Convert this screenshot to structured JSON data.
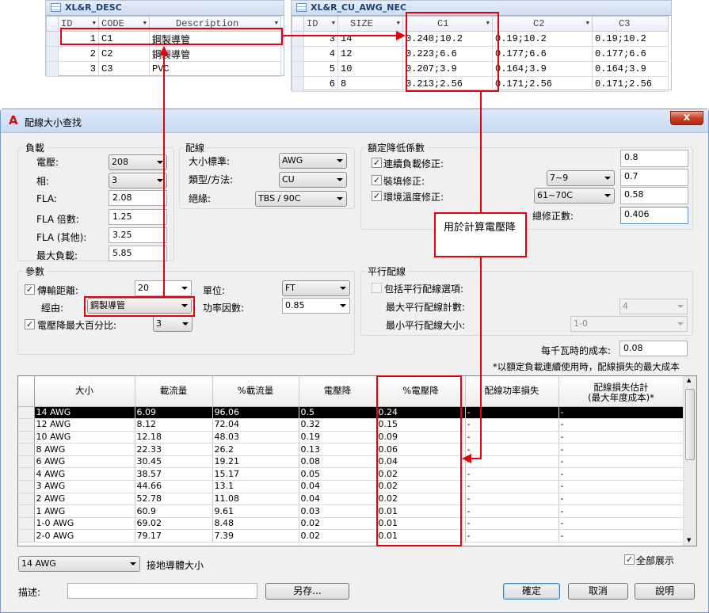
{
  "desc_table": {
    "title": "XL&R_DESC",
    "headers": [
      "ID",
      "CODE",
      "Description"
    ],
    "rows": [
      [
        "1",
        "C1",
        "鋼製導管"
      ],
      [
        "2",
        "C2",
        "鋼製導管"
      ],
      [
        "3",
        "C3",
        "PVC"
      ]
    ]
  },
  "awg_table": {
    "title": "XL&R_CU_AWG_NEC",
    "headers": [
      "ID",
      "SIZE",
      "C1",
      "C2",
      "C3"
    ],
    "rows": [
      [
        "3",
        "14",
        "0.240;10.2",
        "0.19;10.2",
        "0.19;10.2"
      ],
      [
        "4",
        "12",
        "0.223;6.6",
        "0.177;6.6",
        "0.177;6.6"
      ],
      [
        "5",
        "10",
        "0.207;3.9",
        "0.164;3.9",
        "0.164;3.9"
      ],
      [
        "6",
        "8",
        "0.213;2.56",
        "0.171;2.56",
        "0.171;2.56"
      ]
    ]
  },
  "dialog": {
    "title": "配線大小查找",
    "close": "x"
  },
  "load": {
    "title": "負載",
    "voltage_label": "電壓:",
    "voltage_value": "208",
    "phase_label": "相:",
    "phase_value": "3",
    "fla_label": "FLA:",
    "fla_value": "2.08",
    "fla_mult_label": "FLA 倍數:",
    "fla_mult_value": "1.25",
    "fla_other_label": "FLA (其他):",
    "fla_other_value": "3.25",
    "max_load_label": "最大負載:",
    "max_load_value": "5.85"
  },
  "wiring": {
    "title": "配線",
    "size_std_label": "大小標準:",
    "size_std_value": "AWG",
    "type_label": "類型/方法:",
    "type_value": "CU",
    "insulation_label": "絕緣:",
    "insulation_value": "TBS / 90C"
  },
  "derate": {
    "title": "額定降低係數",
    "continuous_label": "連續負載修正:",
    "continuous_value": "0.8",
    "fill_label": "裝填修正:",
    "fill_option": "7~9",
    "fill_value": "0.7",
    "temp_label": "環境溫度修正:",
    "temp_option": "61~70C",
    "temp_value": "0.58",
    "total_label": "總修正數:",
    "total_value": "0.406"
  },
  "params": {
    "title": "參數",
    "distance_label": "傳輸距離:",
    "distance_value": "20",
    "unit_label": "單位:",
    "unit_value": "FT",
    "route_label": "經由:",
    "route_value": "鋼製導管",
    "pf_label": "功率因數:",
    "pf_value": "0.85",
    "vd_label": "電壓降最大百分比:",
    "vd_value": "3"
  },
  "parallel": {
    "title": "平行配線",
    "include_label": "包括平行配線選項:",
    "max_count_label": "最大平行配線計數:",
    "max_count_value": "4",
    "min_size_label": "最小平行配線大小:",
    "min_size_value": "1-0"
  },
  "cost": {
    "label": "每千瓦時的成本:",
    "value": "0.08",
    "footnote": "*以額定負載連續使用時，配線損失的最大成本"
  },
  "callout": "用於計算電壓降",
  "grid": {
    "headers": [
      "大小",
      "載流量",
      "%載流量",
      "電壓降",
      "%電壓降",
      "配線功率損失",
      "配線損失估計\n(最大年度成本)*"
    ],
    "rows": [
      [
        "14 AWG",
        "6.09",
        "96.06",
        "0.5",
        "0.24",
        "-",
        "-"
      ],
      [
        "12 AWG",
        "8.12",
        "72.04",
        "0.32",
        "0.15",
        "-",
        "-"
      ],
      [
        "10 AWG",
        "12.18",
        "48.03",
        "0.19",
        "0.09",
        "-",
        "-"
      ],
      [
        "8 AWG",
        "22.33",
        "26.2",
        "0.13",
        "0.06",
        "-",
        "-"
      ],
      [
        "6 AWG",
        "30.45",
        "19.21",
        "0.08",
        "0.04",
        "-",
        "-"
      ],
      [
        "4 AWG",
        "38.57",
        "15.17",
        "0.05",
        "0.02",
        "-",
        "-"
      ],
      [
        "3 AWG",
        "44.66",
        "13.1",
        "0.04",
        "0.02",
        "-",
        "-"
      ],
      [
        "2 AWG",
        "52.78",
        "11.08",
        "0.04",
        "0.02",
        "-",
        "-"
      ],
      [
        "1 AWG",
        "60.9",
        "9.61",
        "0.03",
        "0.01",
        "-",
        "-"
      ],
      [
        "1-0 AWG",
        "69.02",
        "8.48",
        "0.02",
        "0.01",
        "-",
        "-"
      ],
      [
        "2-0 AWG",
        "79.17",
        "7.39",
        "0.02",
        "0.01",
        "-",
        "-"
      ]
    ]
  },
  "bottom": {
    "ground_value": "14 AWG",
    "ground_label": "接地導體大小",
    "show_all_label": "全部展示",
    "desc_label": "描述:",
    "desc_value": "",
    "save_as": "另存...",
    "ok": "確定",
    "cancel": "取消",
    "help": "說明"
  },
  "icons": [
    "table-icon",
    "autocad-logo-icon",
    "close-icon",
    "dropdown-arrow-icon",
    "checkbox-check-icon",
    "scrollbar-arrow-icon"
  ]
}
